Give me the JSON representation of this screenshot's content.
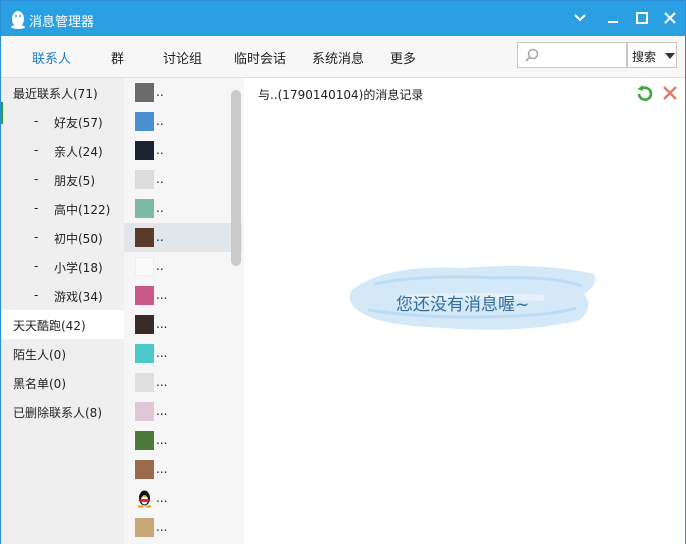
{
  "window": {
    "title": "消息管理器"
  },
  "tabs": [
    {
      "label": "联系人",
      "active": true
    },
    {
      "label": "群"
    },
    {
      "label": "讨论组"
    },
    {
      "label": "临时会话"
    },
    {
      "label": "系统消息"
    },
    {
      "label": "更多"
    }
  ],
  "search": {
    "placeholder": "",
    "button_label": "搜索"
  },
  "categories": [
    {
      "label": "最近联系人(71)",
      "type": "top"
    },
    {
      "label": "好友(57)",
      "type": "sub"
    },
    {
      "label": "亲人(24)",
      "type": "sub"
    },
    {
      "label": "朋友(5)",
      "type": "sub"
    },
    {
      "label": "高中(122)",
      "type": "sub"
    },
    {
      "label": "初中(50)",
      "type": "sub"
    },
    {
      "label": "小学(18)",
      "type": "sub"
    },
    {
      "label": "游戏(34)",
      "type": "sub"
    },
    {
      "label": "天天酷跑(42)",
      "type": "top",
      "selected": true
    },
    {
      "label": "陌生人(0)",
      "type": "top"
    },
    {
      "label": "黑名单(0)",
      "type": "top"
    },
    {
      "label": "已删除联系人(8)",
      "type": "top"
    }
  ],
  "sub_prefix": "-",
  "contacts": [
    {
      "name": "..",
      "color": "#6b6b6b"
    },
    {
      "name": "..",
      "color": "#4a8fd0"
    },
    {
      "name": "..",
      "color": "#1c2430"
    },
    {
      "name": "..",
      "color": "#f0f0f0"
    },
    {
      "name": "..",
      "color": "#7fb9a8"
    },
    {
      "name": "..",
      "color": "#5a3b2a",
      "highlight": true
    },
    {
      "name": "..",
      "color": "#fafafa"
    },
    {
      "name": "...",
      "color": "#c85a8a"
    },
    {
      "name": "...",
      "color": "#3a2b2b"
    },
    {
      "name": "...",
      "color": "#4bc9c9"
    },
    {
      "name": "...",
      "color": "#e8e8e8"
    },
    {
      "name": "...",
      "color": "#e0c8d8"
    },
    {
      "name": "...",
      "color": "#4d7a3a"
    },
    {
      "name": "...",
      "color": "#9a6a4a"
    },
    {
      "name": "...",
      "color": "#e8a020"
    },
    {
      "name": "...",
      "color": "#c9a878"
    }
  ],
  "message_panel": {
    "header": "与..(1790140104)的消息记录",
    "empty_text": "您还没有消息喔~"
  },
  "colors": {
    "titlebar": "#2aa0e2",
    "active_tab": "#1e7dc8",
    "empty_text": "#346c9a"
  }
}
